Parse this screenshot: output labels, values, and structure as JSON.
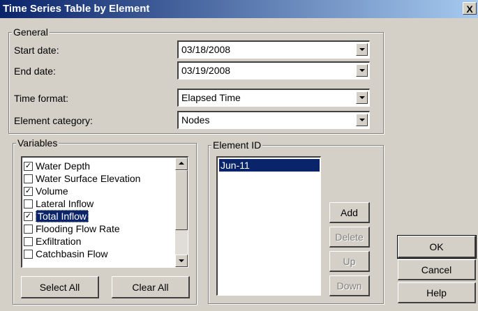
{
  "window": {
    "title": "Time Series Table by Element",
    "close_label": "X"
  },
  "general": {
    "legend": "General",
    "start_date_label": "Start date:",
    "start_date_value": "03/18/2008",
    "end_date_label": "End date:",
    "end_date_value": "03/19/2008",
    "time_format_label": "Time format:",
    "time_format_value": "Elapsed Time",
    "element_category_label": "Element category:",
    "element_category_value": "Nodes"
  },
  "variables": {
    "legend": "Variables",
    "items": [
      {
        "label": "Water Depth",
        "checked": true,
        "mark": "✓"
      },
      {
        "label": "Water Surface Elevation",
        "checked": false,
        "mark": ""
      },
      {
        "label": "Volume",
        "checked": true,
        "mark": "✓"
      },
      {
        "label": "Lateral Inflow",
        "checked": false,
        "mark": ""
      },
      {
        "label": "Total Inflow",
        "checked": true,
        "mark": "✓",
        "selected": true
      },
      {
        "label": "Flooding Flow Rate",
        "checked": false,
        "mark": ""
      },
      {
        "label": "Exfiltration",
        "checked": false,
        "mark": ""
      },
      {
        "label": "Catchbasin Flow",
        "checked": false,
        "mark": ""
      }
    ],
    "select_all_label": "Select All",
    "clear_all_label": "Clear All"
  },
  "element_id": {
    "legend": "Element ID",
    "items": [
      "Jun-11"
    ],
    "add_label": "Add",
    "delete_label": "Delete",
    "up_label": "Up",
    "down_label": "Down"
  },
  "dialog_buttons": {
    "ok_label": "OK",
    "cancel_label": "Cancel",
    "help_label": "Help"
  },
  "icons": {
    "dropdown": "chevron-down-icon",
    "scroll_up": "scroll-up-icon",
    "scroll_down": "scroll-down-icon",
    "check": "checkmark-icon"
  }
}
